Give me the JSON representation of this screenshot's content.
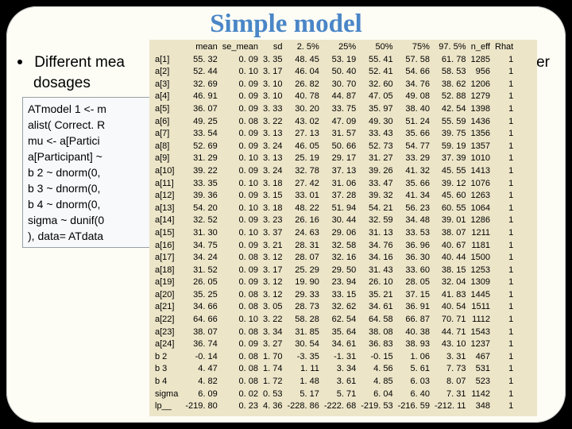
{
  "title": "Simple model",
  "bullet": {
    "left": "Different mea",
    "right": "ther",
    "line2": "dosages"
  },
  "code": {
    "l1": "ATmodel 1 <- m",
    "l2": "alist( Correct. R",
    "l3": "mu <- a[Partici",
    "l4": "a[Participant] ~",
    "l5": "b 2 ~ dnorm(0,",
    "l6": "b 3 ~ dnorm(0,",
    "l7": "b 4 ~ dnorm(0,",
    "l8": "sigma ~ dunif(0",
    "l9": "), data= ATdata"
  },
  "chart_data": {
    "type": "table",
    "columns": [
      "",
      "mean",
      "se_mean",
      "sd",
      "2. 5%",
      "25%",
      "50%",
      "75%",
      "97. 5%",
      "n_eff",
      "Rhat"
    ],
    "rows": [
      [
        "a[1]",
        "55. 32",
        "0. 09",
        "3. 35",
        "48. 45",
        "53. 19",
        "55. 41",
        "57. 58",
        "61. 78",
        "1285",
        "1"
      ],
      [
        "a[2]",
        "52. 44",
        "0. 10",
        "3. 17",
        "46. 04",
        "50. 40",
        "52. 41",
        "54. 66",
        "58. 53",
        "956",
        "1"
      ],
      [
        "a[3]",
        "32. 69",
        "0. 09",
        "3. 10",
        "26. 82",
        "30. 70",
        "32. 60",
        "34. 76",
        "38. 62",
        "1206",
        "1"
      ],
      [
        "a[4]",
        "46. 91",
        "0. 09",
        "3. 10",
        "40. 78",
        "44. 87",
        "47. 05",
        "49. 08",
        "52. 88",
        "1279",
        "1"
      ],
      [
        "a[5]",
        "36. 07",
        "0. 09",
        "3. 33",
        "30. 20",
        "33. 75",
        "35. 97",
        "38. 40",
        "42. 54",
        "1398",
        "1"
      ],
      [
        "a[6]",
        "49. 25",
        "0. 08",
        "3. 22",
        "43. 02",
        "47. 09",
        "49. 30",
        "51. 24",
        "55. 59",
        "1436",
        "1"
      ],
      [
        "a[7]",
        "33. 54",
        "0. 09",
        "3. 13",
        "27. 13",
        "31. 57",
        "33. 43",
        "35. 66",
        "39. 75",
        "1356",
        "1"
      ],
      [
        "a[8]",
        "52. 69",
        "0. 09",
        "3. 24",
        "46. 05",
        "50. 66",
        "52. 73",
        "54. 77",
        "59. 19",
        "1357",
        "1"
      ],
      [
        "a[9]",
        "31. 29",
        "0. 10",
        "3. 13",
        "25. 19",
        "29. 17",
        "31. 27",
        "33. 29",
        "37. 39",
        "1010",
        "1"
      ],
      [
        "a[10]",
        "39. 22",
        "0. 09",
        "3. 24",
        "32. 78",
        "37. 13",
        "39. 26",
        "41. 32",
        "45. 55",
        "1413",
        "1"
      ],
      [
        "a[11]",
        "33. 35",
        "0. 10",
        "3. 18",
        "27. 42",
        "31. 06",
        "33. 47",
        "35. 66",
        "39. 12",
        "1076",
        "1"
      ],
      [
        "a[12]",
        "39. 36",
        "0. 09",
        "3. 15",
        "33. 01",
        "37. 28",
        "39. 32",
        "41. 34",
        "45. 60",
        "1263",
        "1"
      ],
      [
        "a[13]",
        "54. 20",
        "0. 10",
        "3. 18",
        "48. 22",
        "51. 94",
        "54. 21",
        "56. 23",
        "60. 55",
        "1064",
        "1"
      ],
      [
        "a[14]",
        "32. 52",
        "0. 09",
        "3. 23",
        "26. 16",
        "30. 44",
        "32. 59",
        "34. 48",
        "39. 01",
        "1286",
        "1"
      ],
      [
        "a[15]",
        "31. 30",
        "0. 10",
        "3. 37",
        "24. 63",
        "29. 06",
        "31. 13",
        "33. 53",
        "38. 07",
        "1211",
        "1"
      ],
      [
        "a[16]",
        "34. 75",
        "0. 09",
        "3. 21",
        "28. 31",
        "32. 58",
        "34. 76",
        "36. 96",
        "40. 67",
        "1181",
        "1"
      ],
      [
        "a[17]",
        "34. 24",
        "0. 08",
        "3. 12",
        "28. 07",
        "32. 16",
        "34. 16",
        "36. 30",
        "40. 44",
        "1500",
        "1"
      ],
      [
        "a[18]",
        "31. 52",
        "0. 09",
        "3. 17",
        "25. 29",
        "29. 50",
        "31. 43",
        "33. 60",
        "38. 15",
        "1253",
        "1"
      ],
      [
        "a[19]",
        "26. 05",
        "0. 09",
        "3. 12",
        "19. 90",
        "23. 94",
        "26. 10",
        "28. 05",
        "32. 04",
        "1309",
        "1"
      ],
      [
        "a[20]",
        "35. 25",
        "0. 08",
        "3. 12",
        "29. 33",
        "33. 15",
        "35. 21",
        "37. 15",
        "41. 83",
        "1445",
        "1"
      ],
      [
        "a[21]",
        "34. 66",
        "0. 08",
        "3. 05",
        "28. 73",
        "32. 62",
        "34. 61",
        "36. 91",
        "40. 54",
        "1511",
        "1"
      ],
      [
        "a[22]",
        "64. 66",
        "0. 10",
        "3. 22",
        "58. 28",
        "62. 54",
        "64. 58",
        "66. 87",
        "70. 71",
        "1112",
        "1"
      ],
      [
        "a[23]",
        "38. 07",
        "0. 08",
        "3. 34",
        "31. 85",
        "35. 64",
        "38. 08",
        "40. 38",
        "44. 71",
        "1543",
        "1"
      ],
      [
        "a[24]",
        "36. 74",
        "0. 09",
        "3. 27",
        "30. 54",
        "34. 61",
        "36. 83",
        "38. 93",
        "43. 10",
        "1237",
        "1"
      ],
      [
        "b 2",
        "-0. 14",
        "0. 08",
        "1. 70",
        "-3. 35",
        "-1. 31",
        "-0. 15",
        "1. 06",
        "3. 31",
        "467",
        "1"
      ],
      [
        "b 3",
        "4. 47",
        "0. 08",
        "1. 74",
        "1. 11",
        "3. 34",
        "4. 56",
        "5. 61",
        "7. 73",
        "531",
        "1"
      ],
      [
        "b 4",
        "4. 82",
        "0. 08",
        "1. 72",
        "1. 48",
        "3. 61",
        "4. 85",
        "6. 03",
        "8. 07",
        "523",
        "1"
      ],
      [
        "sigma",
        "6. 09",
        "0. 02",
        "0. 53",
        "5. 17",
        "5. 71",
        "6. 04",
        "6. 40",
        "7. 31",
        "1142",
        "1"
      ],
      [
        "lp__",
        "-219. 80",
        "0. 23",
        "4. 36",
        "-228. 86",
        "-222. 68",
        "-219. 53",
        "-216. 59",
        "-212. 11",
        "348",
        "1"
      ]
    ]
  }
}
